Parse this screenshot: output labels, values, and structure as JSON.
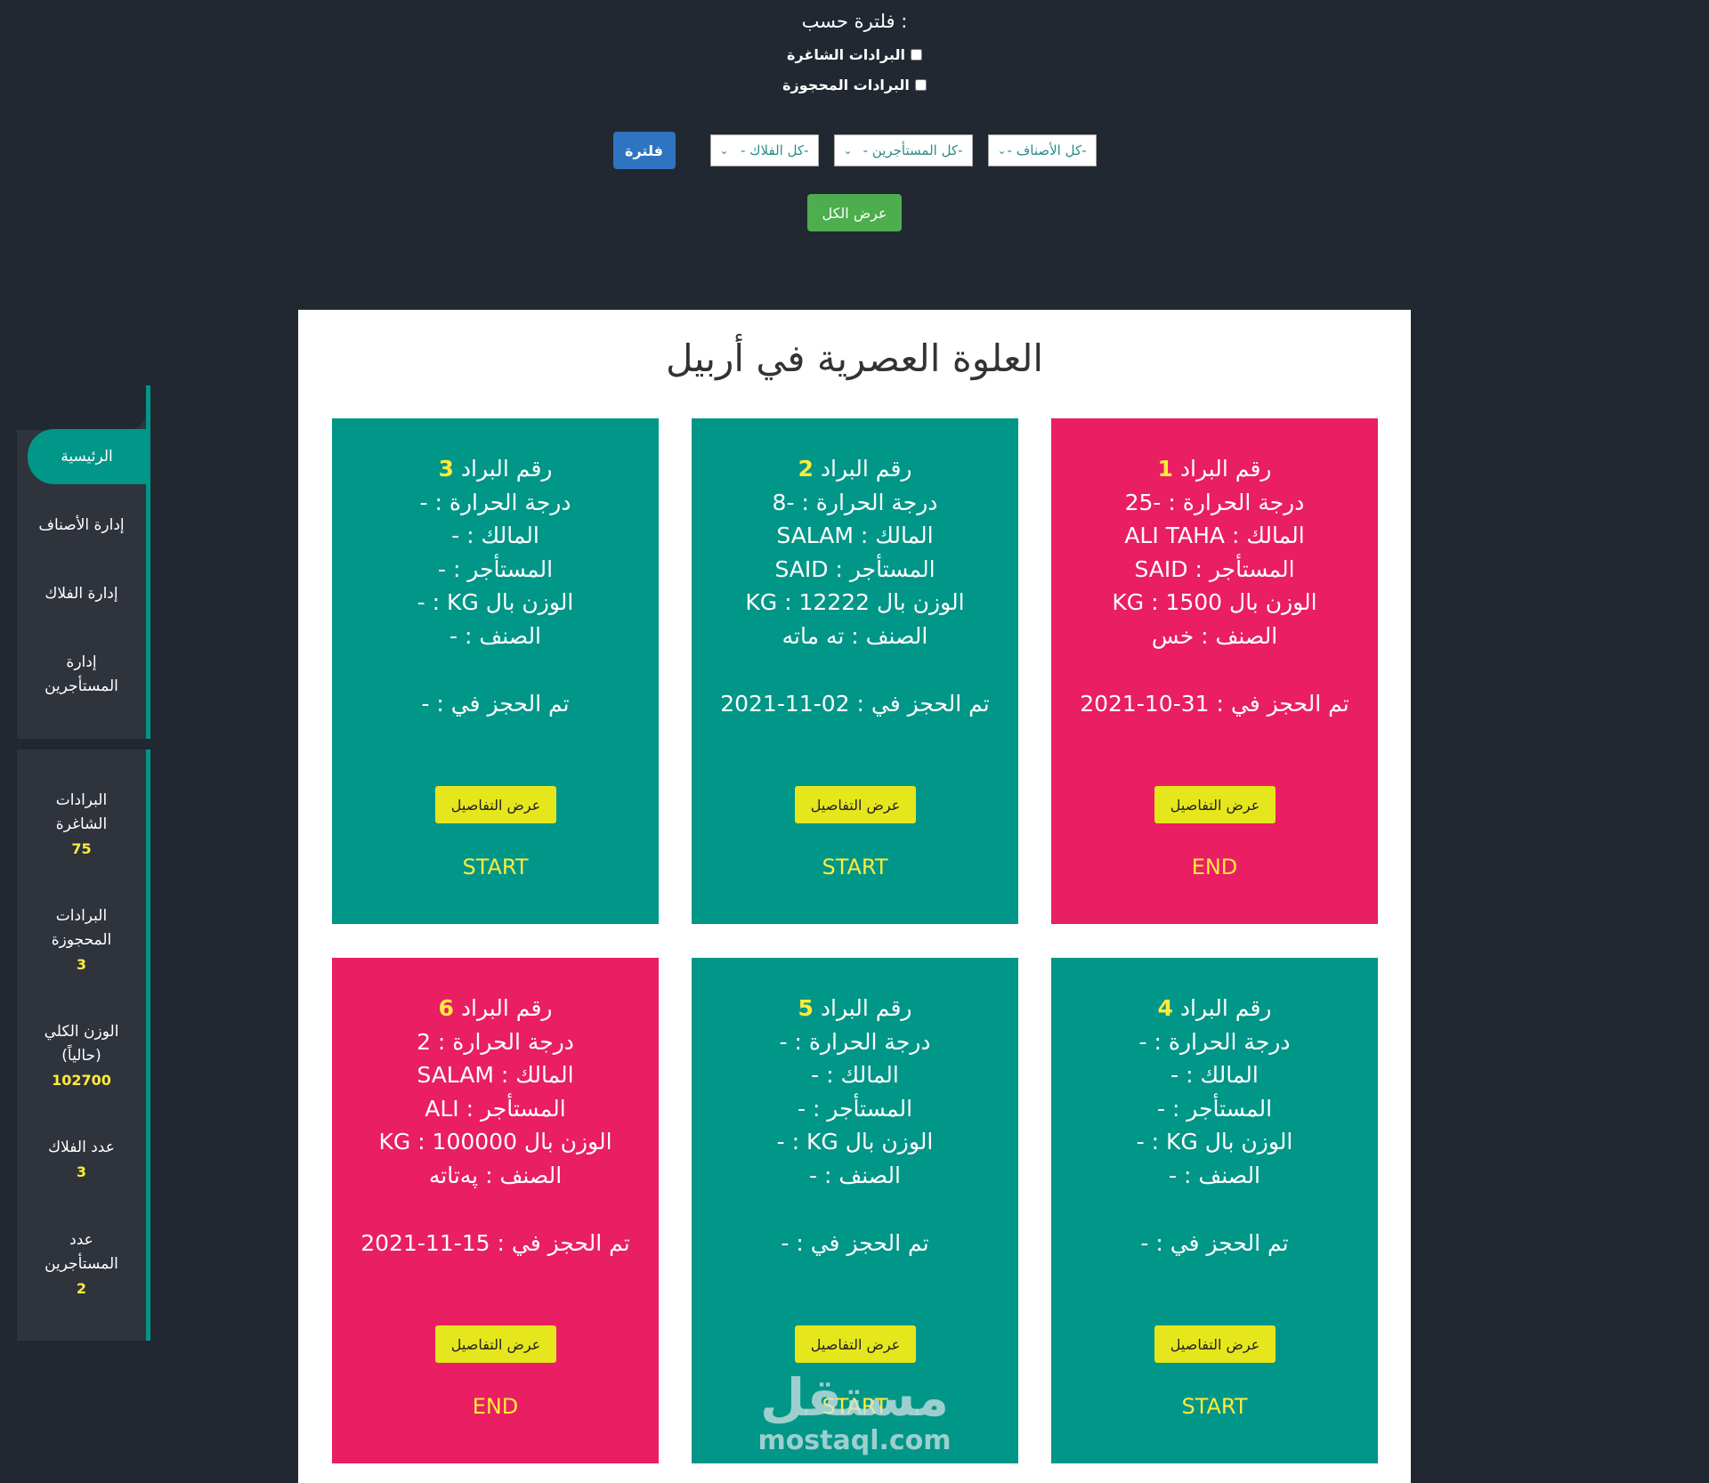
{
  "filter": {
    "title": "فلترة حسب :",
    "checkbox_vacant": "البرادات الشاغرة",
    "checkbox_booked": "البرادات المحجوزة",
    "select_categories": "-كل الأصناف -",
    "select_tenants": "-كل المستأجرين -",
    "select_farmers": "-كل الفلاك -",
    "filter_button": "فلترة",
    "show_all_button": "عرض الكل"
  },
  "sidebar": {
    "nav": [
      {
        "label": "الرئيسية"
      },
      {
        "label": "إدارة الأصناف"
      },
      {
        "label": "إدارة الفلاك"
      },
      {
        "label": "إدارة المستأجرين"
      }
    ],
    "stats": [
      {
        "label": "البرادات الشاغرة",
        "value": "75"
      },
      {
        "label": "البرادات المحجوزة",
        "value": "3"
      },
      {
        "label": "الوزن الكلي (حالياً)",
        "value": "102700"
      },
      {
        "label": "عدد الفلاك",
        "value": "3"
      },
      {
        "label": "عدد المستأجرين",
        "value": "2"
      }
    ]
  },
  "main": {
    "title": "العلوة العصرية في أربيل",
    "labels": {
      "fridge_no": "رقم البراد",
      "temp": "درجة الحرارة :",
      "owner": "المالك :",
      "tenant": "المستأجر :",
      "weight": "الوزن بال KG :",
      "category": "الصنف :",
      "booked_at": "تم الحجز في :",
      "details_button": "عرض التفاصيل"
    },
    "cards": [
      {
        "number": "1",
        "temp": "-25",
        "owner": "ALI TAHA",
        "tenant": "SAID",
        "weight": "1500",
        "category": "خس",
        "booked": "31-10-2021",
        "status": "END",
        "color": "#e91e63"
      },
      {
        "number": "2",
        "temp": "-8",
        "owner": "SALAM",
        "tenant": "SAID",
        "weight": "12222",
        "category": "ته ماته",
        "booked": "02-11-2021",
        "status": "START",
        "color": "#009688"
      },
      {
        "number": "3",
        "temp": "-",
        "owner": "-",
        "tenant": "-",
        "weight": "-",
        "category": "-",
        "booked": "-",
        "status": "START",
        "color": "#009688"
      },
      {
        "number": "4",
        "temp": "-",
        "owner": "-",
        "tenant": "-",
        "weight": "-",
        "category": "-",
        "booked": "-",
        "status": "START",
        "color": "#009688"
      },
      {
        "number": "5",
        "temp": "-",
        "owner": "-",
        "tenant": "-",
        "weight": "-",
        "category": "-",
        "booked": "-",
        "status": "START",
        "color": "#009688"
      },
      {
        "number": "6",
        "temp": "2",
        "owner": "SALAM",
        "tenant": "ALI",
        "weight": "100000",
        "category": "پەتاته",
        "booked": "15-11-2021",
        "status": "END",
        "color": "#e91e63"
      }
    ]
  },
  "watermark": {
    "arabic": "مستقل",
    "latin": "mostaql.com"
  }
}
